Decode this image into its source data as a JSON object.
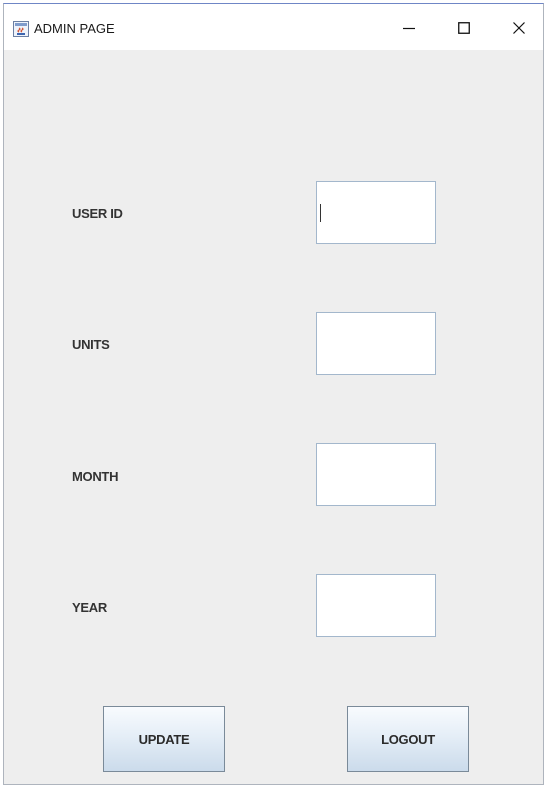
{
  "window": {
    "title": "ADMIN PAGE",
    "icon": "java-app-icon",
    "controls": {
      "minimize_icon": "minimize-icon",
      "maximize_icon": "maximize-icon",
      "close_icon": "close-icon"
    }
  },
  "form": {
    "fields": [
      {
        "label": "USER ID",
        "value": ""
      },
      {
        "label": "UNITS",
        "value": ""
      },
      {
        "label": "MONTH",
        "value": ""
      },
      {
        "label": "YEAR",
        "value": ""
      }
    ],
    "focused_field": "USER ID"
  },
  "buttons": {
    "update_label": "UPDATE",
    "logout_label": "LOGOUT"
  },
  "colors": {
    "window_bg": "#eeeeee",
    "titlebar_bg": "#ffffff",
    "field_border": "#a3b7cc",
    "button_gradient_top": "#f8fbfe",
    "button_gradient_bottom": "#cbdbeb"
  }
}
